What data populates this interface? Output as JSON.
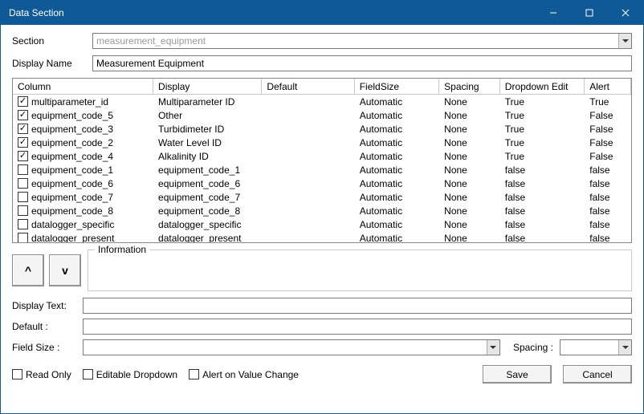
{
  "window": {
    "title": "Data Section"
  },
  "labels": {
    "section": "Section",
    "display_name": "Display Name",
    "information": "Information",
    "display_text": "Display Text:",
    "default": "Default  :",
    "field_size": "Field Size :",
    "spacing": "Spacing :",
    "read_only": "Read Only",
    "editable_dropdown": "Editable Dropdown",
    "alert_on_value_change": "Alert on Value Change",
    "save": "Save",
    "cancel": "Cancel",
    "up": "^",
    "down": "v"
  },
  "fields": {
    "section": "measurement_equipment",
    "display_name": "Measurement Equipment",
    "display_text": "",
    "default": "",
    "field_size": "",
    "spacing": ""
  },
  "grid": {
    "headers": [
      "Column",
      "Display",
      "Default",
      "FieldSize",
      "Spacing",
      "Dropdown Edit",
      "Alert"
    ],
    "rows": [
      {
        "checked": true,
        "column": "multiparameter_id",
        "display": "Multiparameter ID",
        "default": "",
        "fieldsize": "Automatic",
        "spacing": "None",
        "dropdown": "True",
        "alert": "True"
      },
      {
        "checked": true,
        "column": "equipment_code_5",
        "display": "Other",
        "default": "",
        "fieldsize": "Automatic",
        "spacing": "None",
        "dropdown": "True",
        "alert": "False"
      },
      {
        "checked": true,
        "column": "equipment_code_3",
        "display": "Turbidimeter ID",
        "default": "",
        "fieldsize": "Automatic",
        "spacing": "None",
        "dropdown": "True",
        "alert": "False"
      },
      {
        "checked": true,
        "column": "equipment_code_2",
        "display": "Water Level ID",
        "default": "",
        "fieldsize": "Automatic",
        "spacing": "None",
        "dropdown": "True",
        "alert": "False"
      },
      {
        "checked": true,
        "column": "equipment_code_4",
        "display": "Alkalinity ID",
        "default": "",
        "fieldsize": "Automatic",
        "spacing": "None",
        "dropdown": "True",
        "alert": "False"
      },
      {
        "checked": false,
        "column": "equipment_code_1",
        "display": "equipment_code_1",
        "default": "",
        "fieldsize": "Automatic",
        "spacing": "None",
        "dropdown": "false",
        "alert": "false"
      },
      {
        "checked": false,
        "column": "equipment_code_6",
        "display": "equipment_code_6",
        "default": "",
        "fieldsize": "Automatic",
        "spacing": "None",
        "dropdown": "false",
        "alert": "false"
      },
      {
        "checked": false,
        "column": "equipment_code_7",
        "display": "equipment_code_7",
        "default": "",
        "fieldsize": "Automatic",
        "spacing": "None",
        "dropdown": "false",
        "alert": "false"
      },
      {
        "checked": false,
        "column": "equipment_code_8",
        "display": "equipment_code_8",
        "default": "",
        "fieldsize": "Automatic",
        "spacing": "None",
        "dropdown": "false",
        "alert": "false"
      },
      {
        "checked": false,
        "column": "datalogger_specific",
        "display": "datalogger_specific",
        "default": "",
        "fieldsize": "Automatic",
        "spacing": "None",
        "dropdown": "false",
        "alert": "false"
      },
      {
        "checked": false,
        "column": "datalogger_present",
        "display": "datalogger_present",
        "default": "",
        "fieldsize": "Automatic",
        "spacing": "None",
        "dropdown": "false",
        "alert": "false"
      }
    ]
  }
}
